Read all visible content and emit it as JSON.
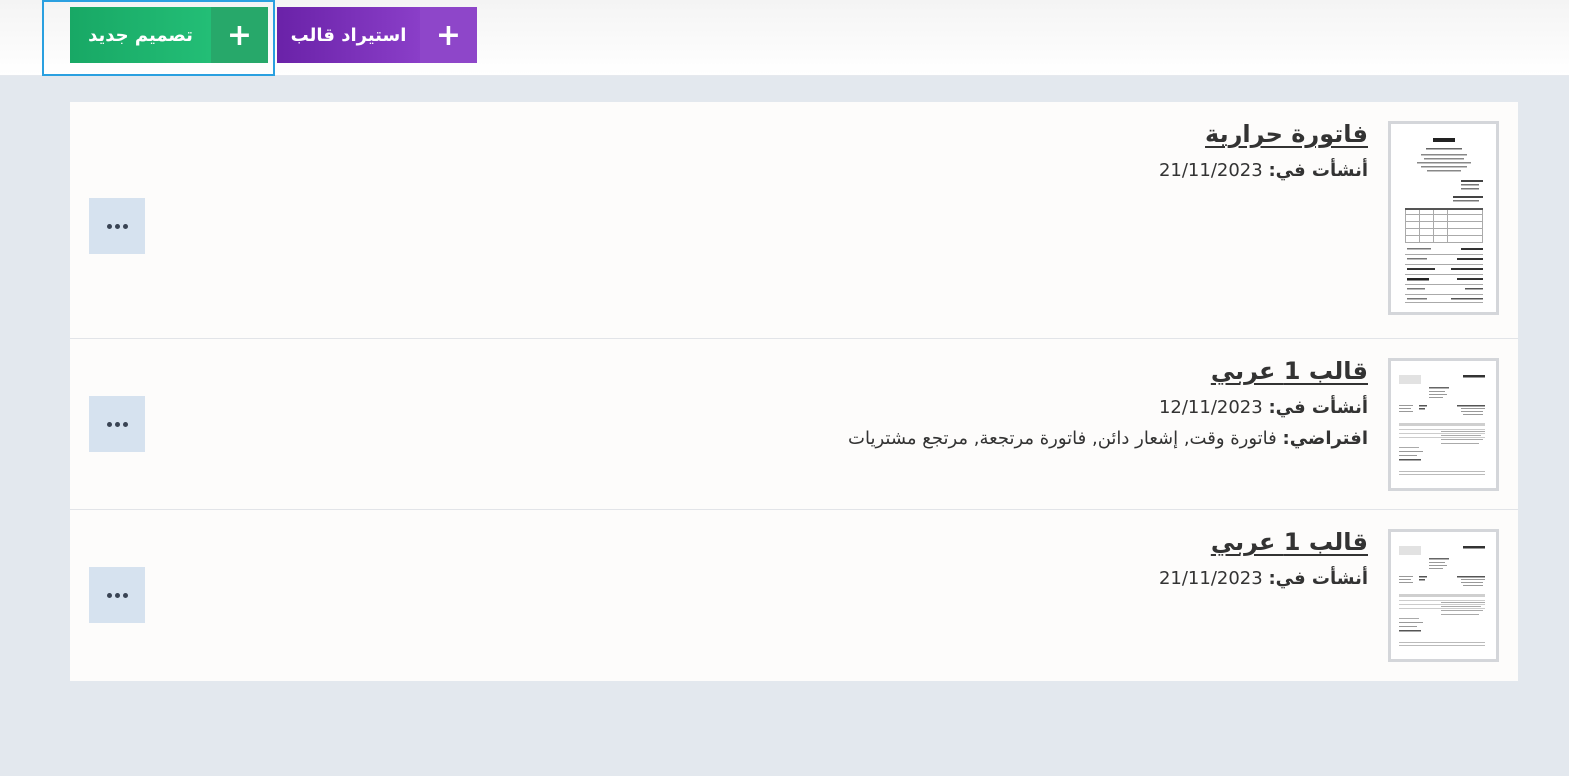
{
  "toolbar": {
    "new_design_label": "تصميم جديد",
    "import_template_label": "استيراد قالب",
    "plus_glyph": "+"
  },
  "templates": [
    {
      "title": "فاتورة حرارية",
      "created_label": "أنشأت في:",
      "created_date": "21/11/2023"
    },
    {
      "title": "قالب 1 عربي",
      "created_label": "أنشأت في:",
      "created_date": "12/11/2023",
      "default_label": "افتراضي:",
      "default_value": "فاتورة وقت, إشعار دائن, فاتورة مرتجعة, مرتجع مشتريات"
    },
    {
      "title": "قالب 1 عربي",
      "created_label": "أنشأت في:",
      "created_date": "21/11/2023"
    }
  ],
  "icons": {
    "more": "more-horizontal-icon",
    "add": "plus-icon"
  },
  "colors": {
    "new_button": "#1fb673",
    "import_button": "#7a2fb8",
    "focus_ring": "#2aa0e0",
    "more_button_bg": "#d6e2ef"
  }
}
